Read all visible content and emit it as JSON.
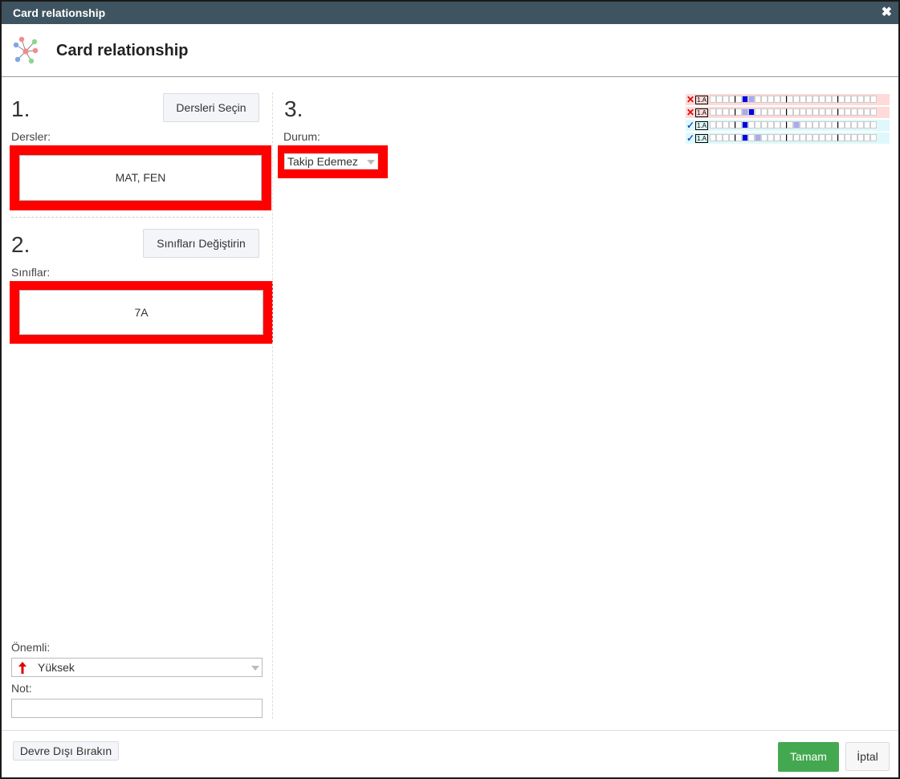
{
  "window": {
    "title": "Card relationship",
    "close_glyph": "✖"
  },
  "header": {
    "title": "Card relationship",
    "icon": "network-nodes-icon"
  },
  "section1": {
    "number": "1.",
    "button_label": "Dersleri Seçin",
    "field_label": "Dersler:",
    "value": "MAT, FEN"
  },
  "section2": {
    "number": "2.",
    "button_label": "Sınıfları Değiştirin",
    "field_label": "Sınıflar:",
    "value": "7A"
  },
  "section3": {
    "number": "3.",
    "field_label": "Durum:",
    "selected": "Takip Edemez"
  },
  "importance": {
    "label": "Önemli:",
    "selected": "Yüksek",
    "icon": "red-up-arrow-icon"
  },
  "note": {
    "label": "Not:",
    "value": ""
  },
  "footer": {
    "disable_button": "Devre Dışı Bırakın",
    "ok_button": "Tamam",
    "cancel_button": "İptal"
  },
  "preview_rows": [
    {
      "status": "invalid",
      "mark": "✕",
      "tag": "1.A",
      "color": "#ffdada",
      "mark_color": "#e00000"
    },
    {
      "status": "invalid",
      "mark": "✕",
      "tag": "1.A",
      "color": "#ffdada",
      "mark_color": "#e00000"
    },
    {
      "status": "valid",
      "mark": "✓",
      "tag": "1.A",
      "color": "#dff8fb",
      "mark_color": "#1a55d0"
    },
    {
      "status": "valid",
      "mark": "✓",
      "tag": "1.A",
      "color": "#dff8fb",
      "mark_color": "#1a55d0"
    }
  ],
  "colors": {
    "accent_ok": "#44a850",
    "highlight": "#ff0000",
    "titlebar": "#3f5461"
  }
}
